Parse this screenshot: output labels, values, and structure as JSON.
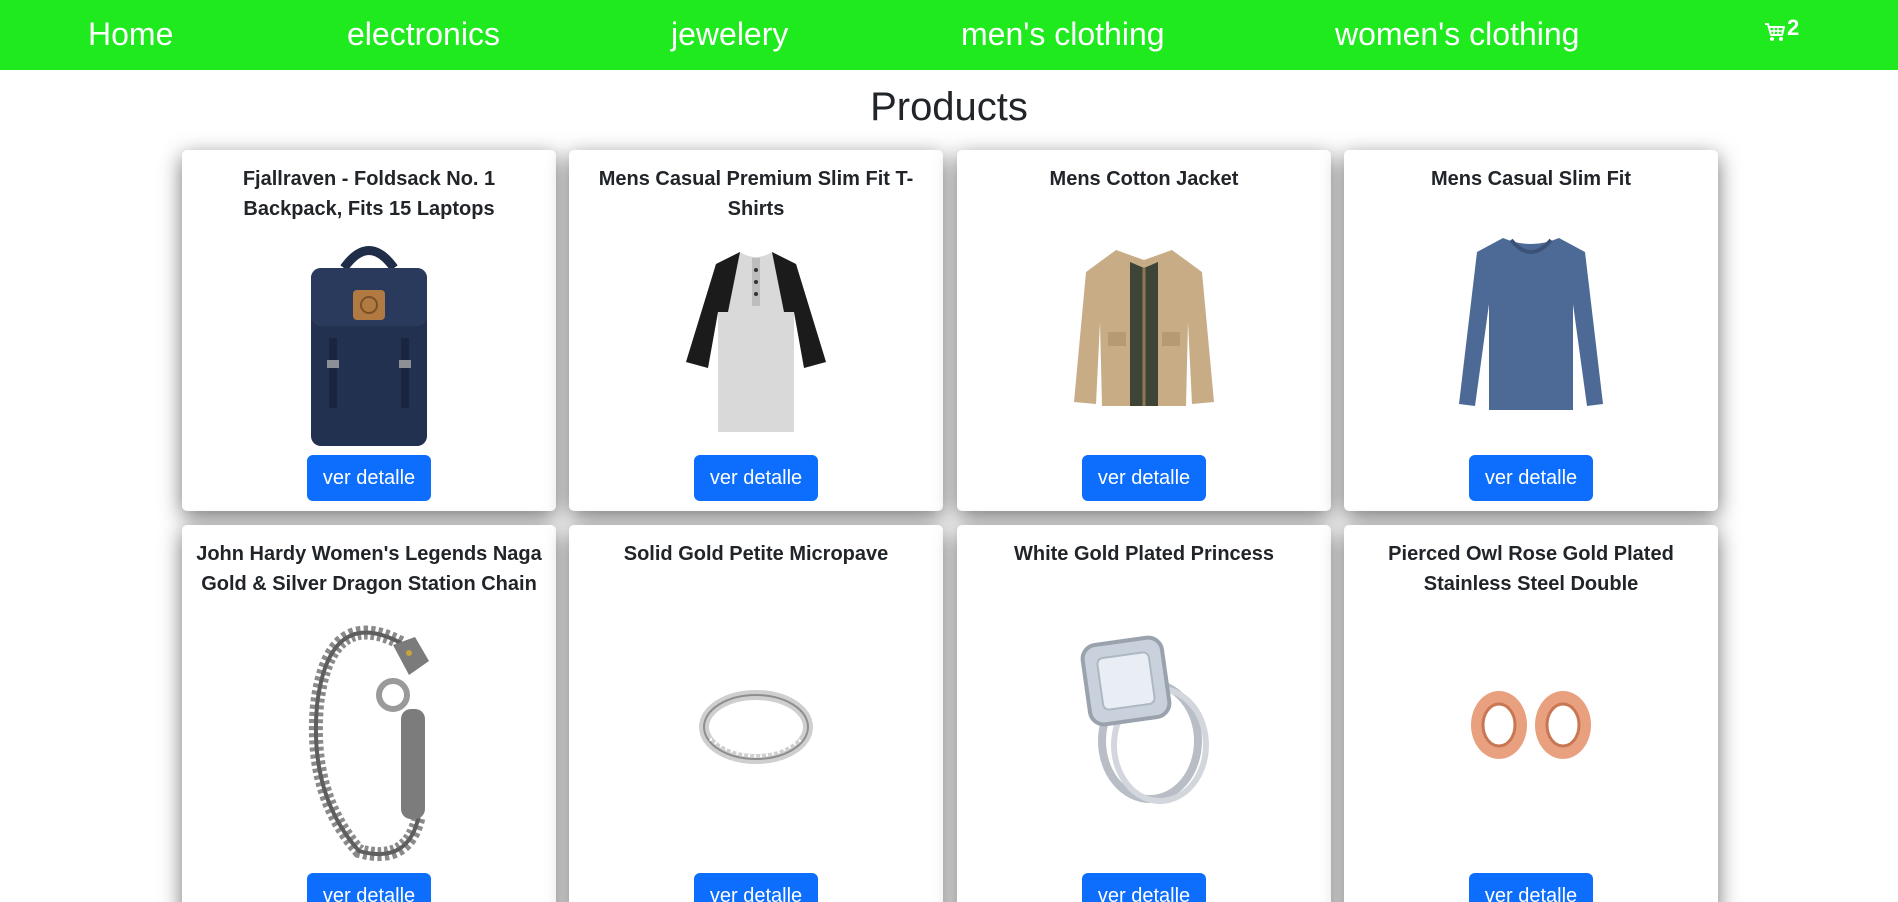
{
  "nav": {
    "home": "Home",
    "electronics": "electronics",
    "jewelery": "jewelery",
    "mens": "men's clothing",
    "womens": "women's clothing",
    "cart_icon": "cart-icon",
    "cart_count": "2"
  },
  "page_title": "Products",
  "products": [
    {
      "title": "Fjallraven - Foldsack No. 1 Backpack, Fits 15 Laptops",
      "image": "backpack-image",
      "button": "ver detalle"
    },
    {
      "title": "Mens Casual Premium Slim Fit T-Shirts",
      "image": "tshirt-image",
      "button": "ver detalle"
    },
    {
      "title": "Mens Cotton Jacket",
      "image": "jacket-image",
      "button": "ver detalle"
    },
    {
      "title": "Mens Casual Slim Fit",
      "image": "longsleeve-image",
      "button": "ver detalle"
    },
    {
      "title": "John Hardy Women's Legends Naga Gold & Silver Dragon Station Chain",
      "image": "bracelet-image",
      "button": "ver detalle"
    },
    {
      "title": "Solid Gold Petite Micropave",
      "image": "ring-image",
      "button": "ver detalle"
    },
    {
      "title": "White Gold Plated Princess",
      "image": "diamond-ring-image",
      "button": "ver detalle"
    },
    {
      "title": "Pierced Owl Rose Gold Plated Stainless Steel Double",
      "image": "tunnel-plugs-image",
      "button": "ver detalle"
    }
  ],
  "colors": {
    "navbar": "#1eea1e",
    "button": "#0d6efd"
  }
}
